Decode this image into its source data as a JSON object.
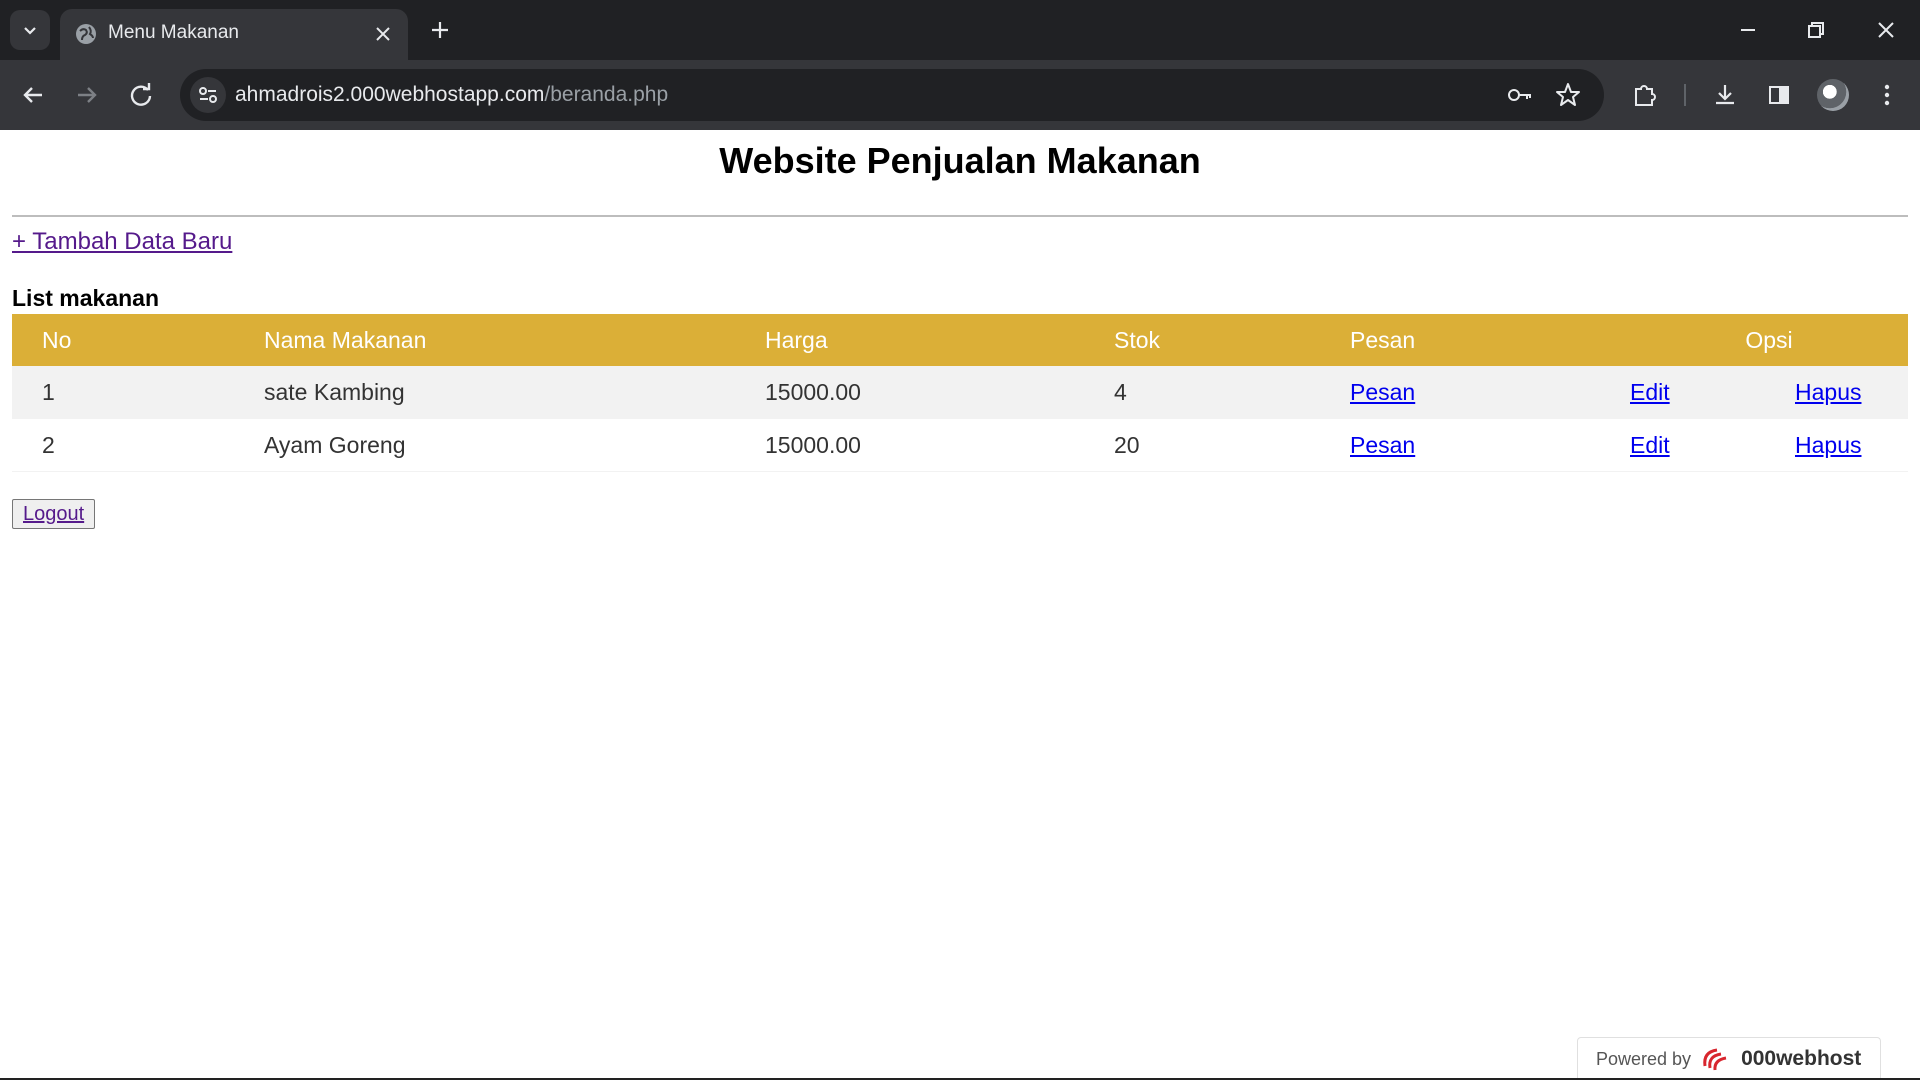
{
  "browser": {
    "tab_title": "Menu Makanan",
    "url_host": "ahmadrois2.000webhostapp.com",
    "url_path": "/beranda.php"
  },
  "page": {
    "title": "Website Penjualan Makanan",
    "add_link": "+ Tambah Data Baru",
    "list_title": "List makanan",
    "table": {
      "headers": [
        "No",
        "Nama Makanan",
        "Harga",
        "Stok",
        "Pesan",
        "Opsi"
      ],
      "rows": [
        {
          "no": "1",
          "nama": "sate Kambing",
          "harga": "15000.00",
          "stok": "4",
          "pesan": "Pesan",
          "edit": "Edit",
          "hapus": "Hapus"
        },
        {
          "no": "2",
          "nama": "Ayam Goreng",
          "harga": "15000.00",
          "stok": "20",
          "pesan": "Pesan",
          "edit": "Edit",
          "hapus": "Hapus"
        }
      ]
    },
    "logout_label": "Logout"
  },
  "footer": {
    "powered_by": "Powered by",
    "brand": "000webhost"
  },
  "colors": {
    "table_header": "#dbaf37",
    "link": "#0000ee",
    "visited_link": "#551a8b"
  }
}
